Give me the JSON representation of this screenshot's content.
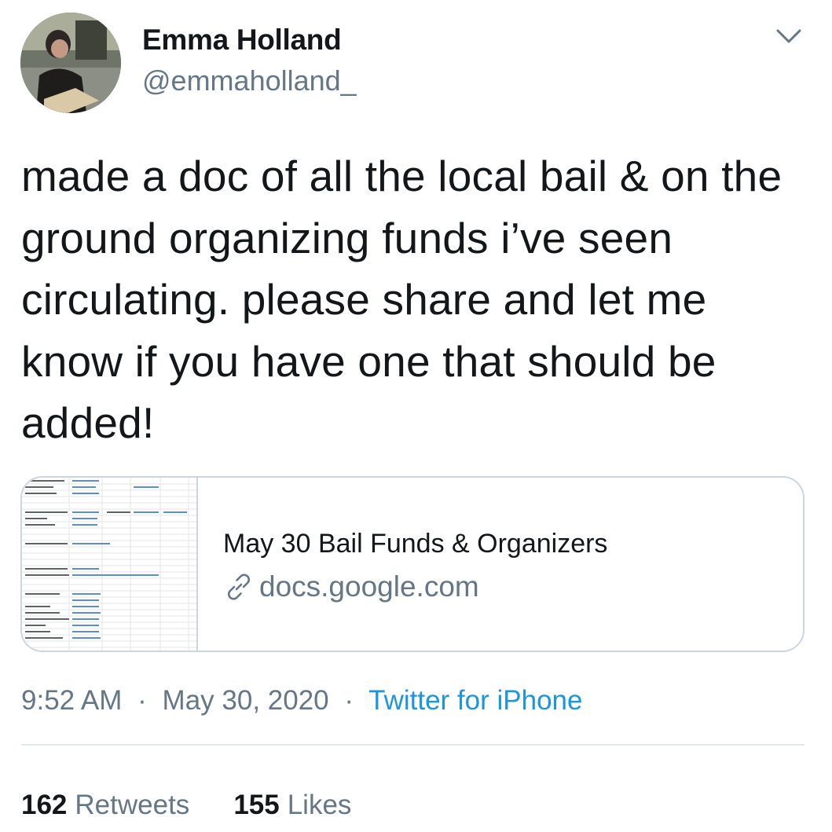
{
  "author": {
    "name": "Emma Holland",
    "handle": "@emmaholland_"
  },
  "tweet": {
    "text": "made a doc of all the local bail & on the ground organizing funds i’ve seen circulating. please share and let me know if you have one that should be added!"
  },
  "link_card": {
    "title": "May 30 Bail Funds & Organizers",
    "domain": "docs.google.com"
  },
  "meta": {
    "time": "9:52 AM",
    "separator": "·",
    "date": "May 30, 2020",
    "source": "Twitter for iPhone"
  },
  "stats": {
    "retweets_count": "162",
    "retweets_label": "Retweets",
    "likes_count": "155",
    "likes_label": "Likes"
  },
  "colors": {
    "text": "#14171a",
    "secondary": "#657786",
    "accent": "#1b95e0",
    "border": "#ccd6dd"
  },
  "icons": [
    "chevron-down-icon",
    "link-icon"
  ]
}
